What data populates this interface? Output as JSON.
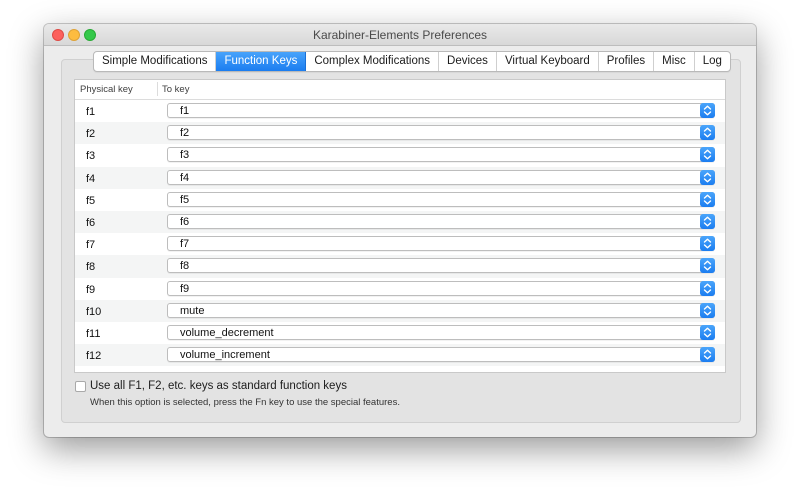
{
  "window": {
    "title": "Karabiner-Elements Preferences"
  },
  "tabs": [
    {
      "label": "Simple Modifications",
      "active": false
    },
    {
      "label": "Function Keys",
      "active": true
    },
    {
      "label": "Complex Modifications",
      "active": false
    },
    {
      "label": "Devices",
      "active": false
    },
    {
      "label": "Virtual Keyboard",
      "active": false
    },
    {
      "label": "Profiles",
      "active": false
    },
    {
      "label": "Misc",
      "active": false
    },
    {
      "label": "Log",
      "active": false
    }
  ],
  "table": {
    "columns": [
      "Physical key",
      "To key"
    ],
    "rows": [
      {
        "physical": "f1",
        "to": "f1"
      },
      {
        "physical": "f2",
        "to": "f2"
      },
      {
        "physical": "f3",
        "to": "f3"
      },
      {
        "physical": "f4",
        "to": "f4"
      },
      {
        "physical": "f5",
        "to": "f5"
      },
      {
        "physical": "f6",
        "to": "f6"
      },
      {
        "physical": "f7",
        "to": "f7"
      },
      {
        "physical": "f8",
        "to": "f8"
      },
      {
        "physical": "f9",
        "to": "f9"
      },
      {
        "physical": "f10",
        "to": "mute"
      },
      {
        "physical": "f11",
        "to": "volume_decrement"
      },
      {
        "physical": "f12",
        "to": "volume_increment"
      }
    ]
  },
  "option": {
    "label": "Use all F1, F2, etc. keys as standard function keys",
    "checked": false,
    "note": "When this option is selected, press the Fn key to use the special features."
  },
  "colors": {
    "accent": "#1b7df0",
    "close": "#fc605c",
    "minimize": "#fdbc40",
    "zoom": "#34c84a"
  },
  "icons": {
    "select_stepper": "chevron-up-down-icon"
  }
}
